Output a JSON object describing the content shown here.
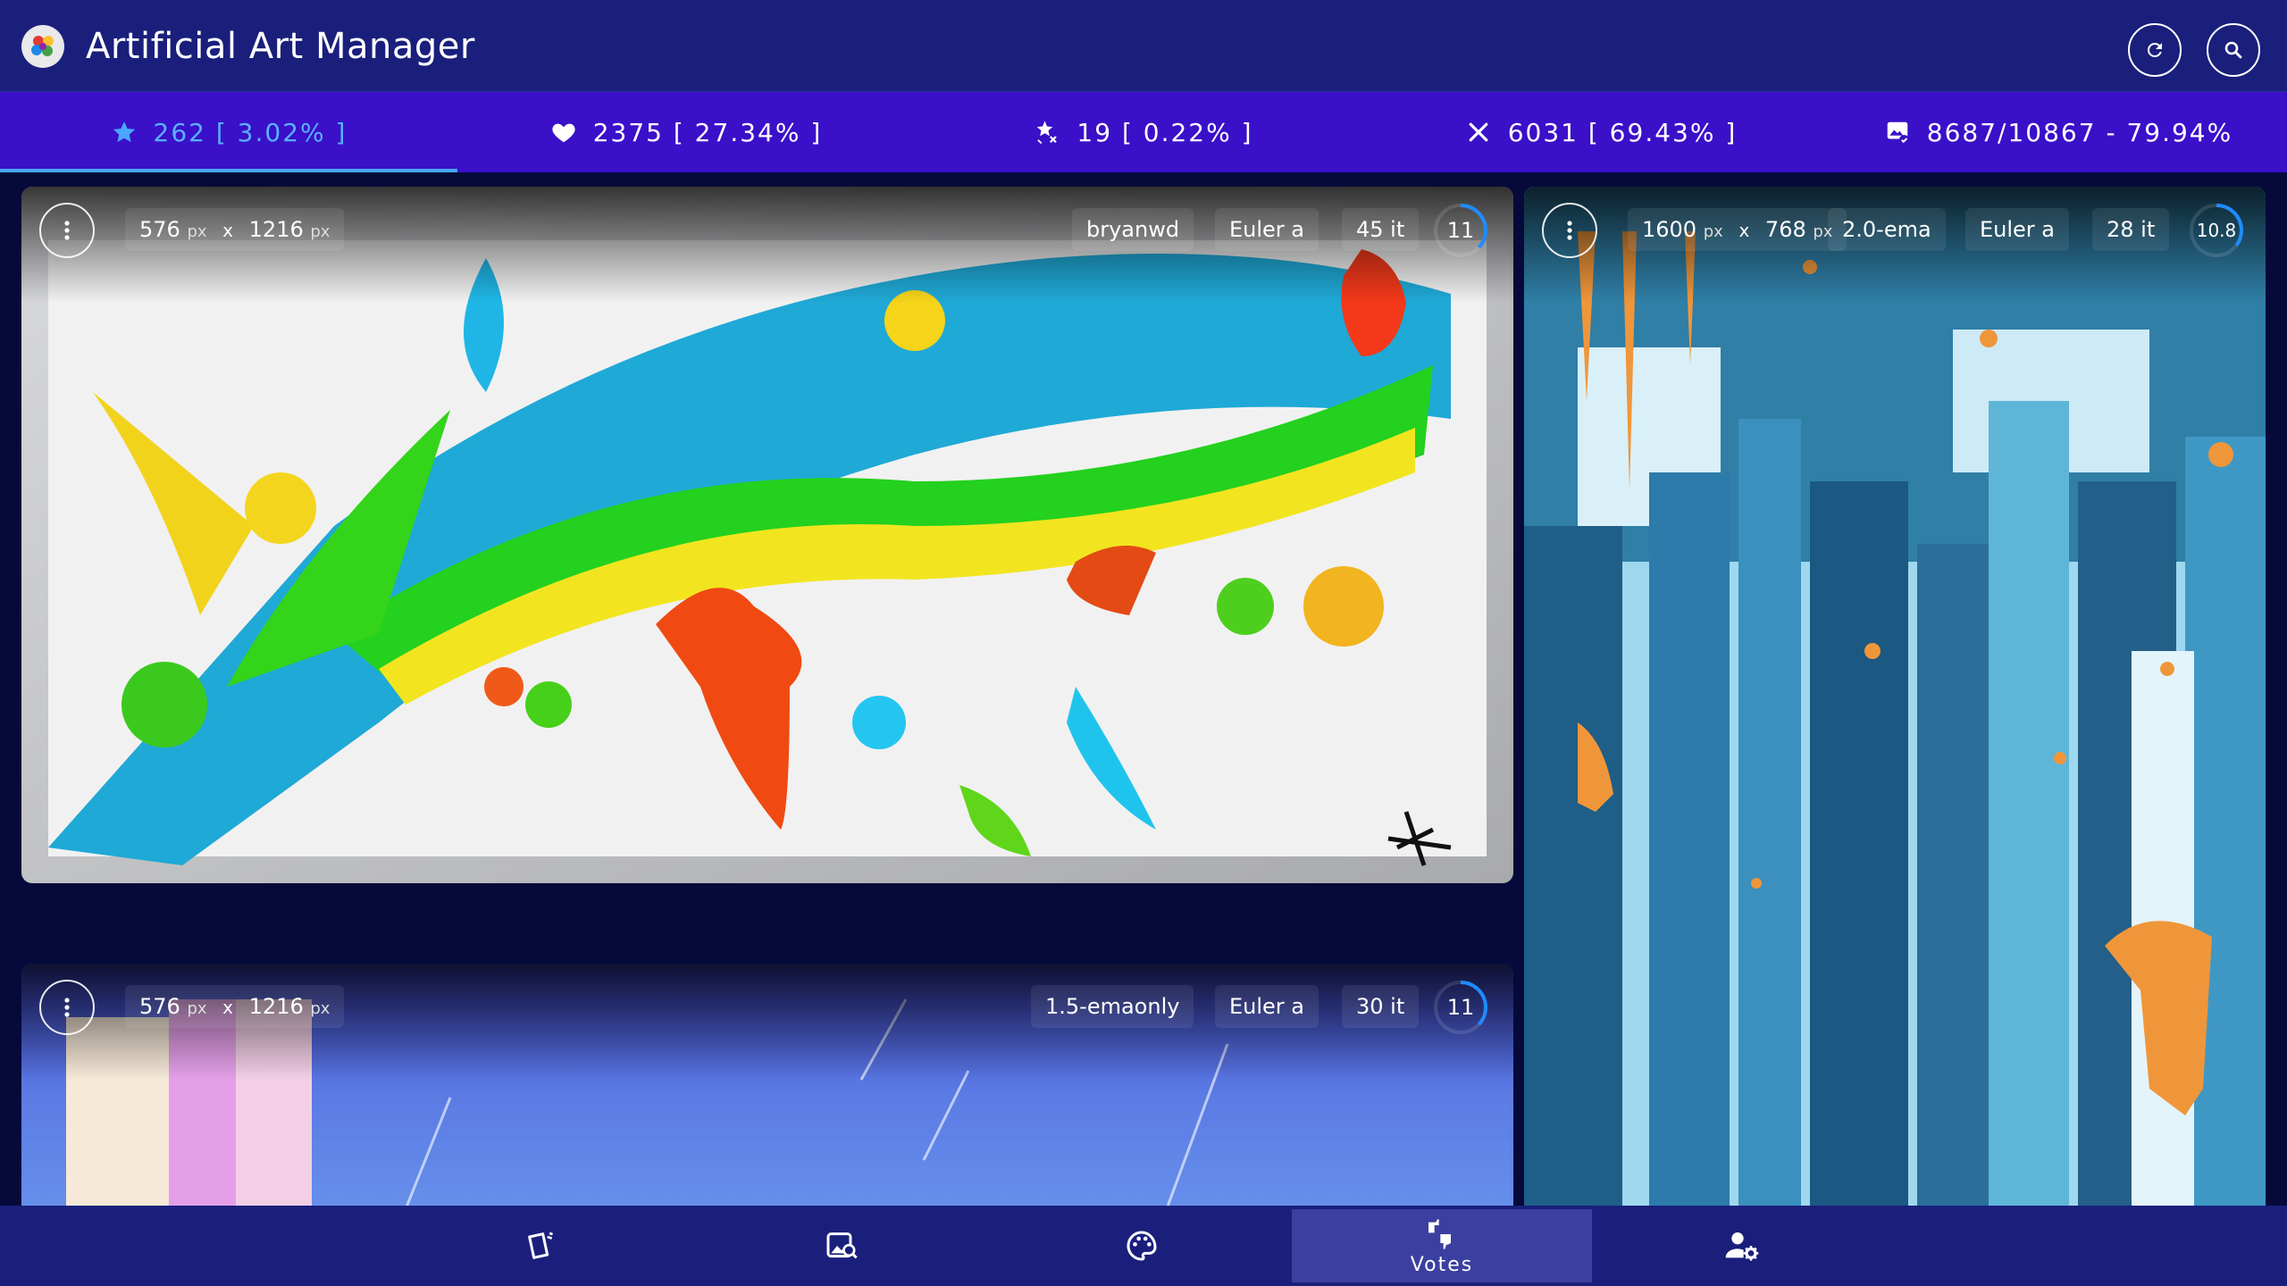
{
  "app": {
    "title": "Artificial Art Manager"
  },
  "colors": {
    "appbar": "#1a1f7c",
    "statbar": "#3a10c9",
    "active_accent": "#4aa6ff",
    "background": "#050a3a"
  },
  "stats": [
    {
      "icon": "star-icon",
      "label": "262 [ 3.02% ]",
      "active": true
    },
    {
      "icon": "heart-icon",
      "label": "2375 [ 27.34% ]",
      "active": false
    },
    {
      "icon": "star-off-icon",
      "label": "19 [ 0.22% ]",
      "active": false
    },
    {
      "icon": "close-icon",
      "label": "6031 [ 69.43% ]",
      "active": false
    },
    {
      "icon": "image-check-icon",
      "label": "8687/10867 - 79.94%",
      "active": false
    }
  ],
  "cards": [
    {
      "width": "576",
      "height": "1216",
      "unit": "px",
      "times": "x",
      "model": "bryanwd",
      "sampler": "Euler a",
      "steps": "45 it",
      "cfg": "11"
    },
    {
      "width": "1600",
      "height": "768",
      "unit": "px",
      "times": "x",
      "model": "2.0-ema",
      "sampler": "Euler a",
      "steps": "28 it",
      "cfg": "10.8"
    },
    {
      "width": "576",
      "height": "1216",
      "unit": "px",
      "times": "x",
      "model": "1.5-emaonly",
      "sampler": "Euler a",
      "steps": "30 it",
      "cfg": "11"
    }
  ],
  "nav": {
    "items": [
      {
        "icon": "cards-icon",
        "label": ""
      },
      {
        "icon": "image-search-icon",
        "label": ""
      },
      {
        "icon": "palette-icon",
        "label": ""
      },
      {
        "icon": "thumbs-up-down-icon",
        "label": "Votes",
        "active": true
      },
      {
        "icon": "account-cog-icon",
        "label": ""
      }
    ]
  }
}
